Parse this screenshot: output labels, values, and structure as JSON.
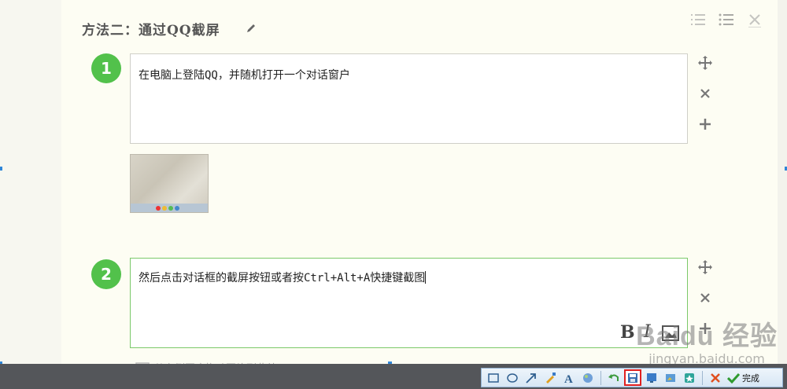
{
  "section": {
    "title": "方法二：通过QQ截屏",
    "edit_icon": "pencil-icon",
    "top_tools": [
      "ordered-list-icon",
      "unordered-list-icon",
      "close-icon"
    ]
  },
  "steps": [
    {
      "number": "1",
      "text": "在电脑上登陆QQ，并随机打开一个对话窗户"
    },
    {
      "number": "2",
      "text": "然后点击对话框的截屏按钮或者按Ctrl+Alt+A快捷键截图"
    }
  ],
  "step_tools": [
    "move-icon",
    "close-icon",
    "plus-icon"
  ],
  "format_buttons": {
    "bold": "B",
    "italic": "I"
  },
  "drag_hint": "从右侧图库拖动图片到此处",
  "watermark": {
    "logo": "Baidu 经验",
    "url": "jingyan.baidu.com"
  },
  "screenshot_toolbar": {
    "tools": [
      "rectangle-icon",
      "ellipse-icon",
      "arrow-icon",
      "brush-icon",
      "text-icon",
      "mosaic-icon",
      "undo-icon",
      "save-icon",
      "screen-icon",
      "edit-image-icon",
      "favorite-icon",
      "cancel-icon"
    ],
    "selected": "save-icon",
    "done_label": "完成"
  },
  "colors": {
    "accent_green": "#52c14b",
    "selection_blue": "#3a8fd6",
    "highlight_red": "#e02020"
  }
}
